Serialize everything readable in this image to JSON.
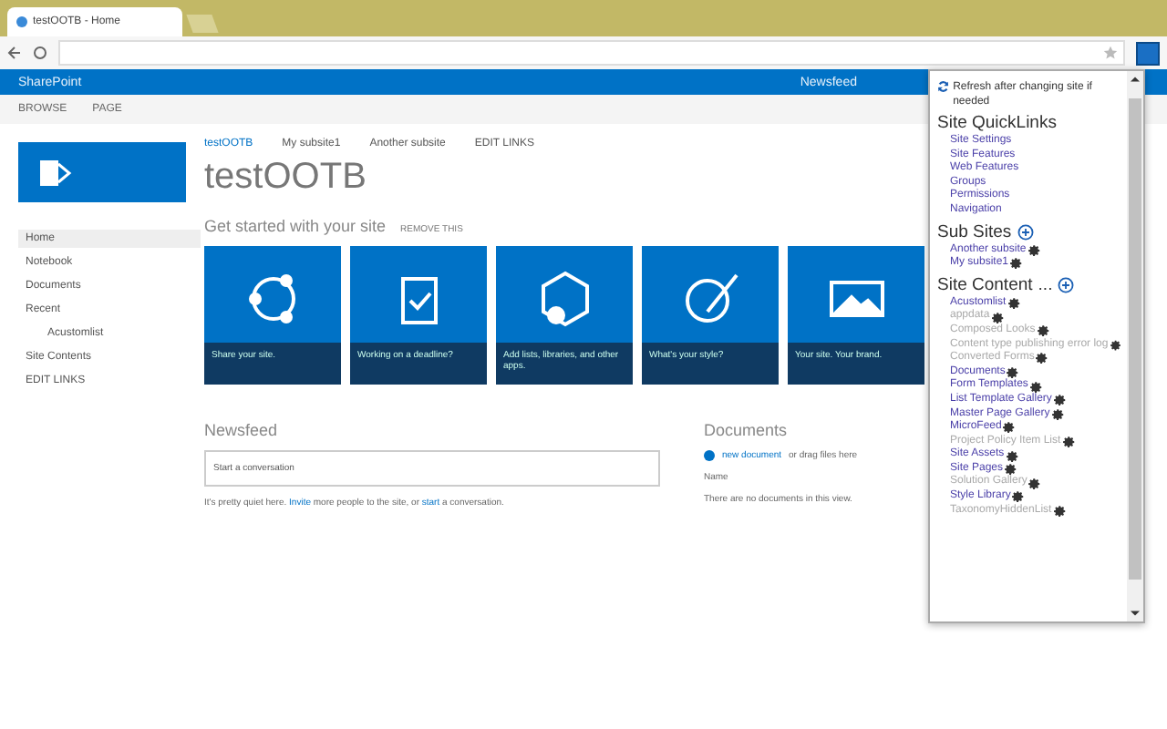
{
  "browser": {
    "tab_title": "testOOTB - Home"
  },
  "suite_bar": {
    "brand": "SharePoint",
    "links": [
      "Newsfeed"
    ]
  },
  "ribbon": {
    "tabs": [
      "BROWSE",
      "PAGE"
    ]
  },
  "site": {
    "top_links": [
      {
        "label": "testOOTB",
        "selected": true
      },
      {
        "label": "My subsite1",
        "selected": false
      },
      {
        "label": "Another subsite",
        "selected": false
      },
      {
        "label": "EDIT LINKS",
        "selected": false
      }
    ],
    "title": "testOOTB",
    "get_started": "Get started with your site",
    "remove": "REMOVE THIS"
  },
  "quick_launch": [
    {
      "label": "Home",
      "selected": true
    },
    {
      "label": "Notebook",
      "selected": false
    },
    {
      "label": "Documents",
      "selected": false
    },
    {
      "label": "Recent",
      "selected": false,
      "children": [
        {
          "label": "Acustomlist",
          "selected": false
        }
      ]
    },
    {
      "label": "Site Contents",
      "selected": false
    }
  ],
  "edit_links": "EDIT LINKS",
  "tiles": [
    "Share your site.",
    "Working on a deadline?",
    "Add lists, libraries, and other apps.",
    "What's your style?",
    "Your site. Your brand."
  ],
  "newsfeed": {
    "title": "Newsfeed",
    "placeholder": "Start a conversation",
    "note": "It's pretty quiet here. **Invite** more people to the site, or **start** a conversation."
  },
  "documents": {
    "title": "Documents",
    "new_link": "new document",
    "new_rest": "or drag files here",
    "name_col": "Name",
    "empty": "There are no documents in this view."
  },
  "popup": {
    "refresh": "Refresh after changing site if needed",
    "quicklinks_title": "Site QuickLinks",
    "quicklinks": [
      "Site Settings",
      "Site Features",
      "Web Features",
      "Groups",
      "Permissions",
      "Navigation"
    ],
    "subsites_title": "Sub Sites",
    "subsites": [
      "Another subsite",
      "My subsite1"
    ],
    "content_title": "Site Content",
    "more": "...",
    "content": [
      {
        "label": "Acustomlist",
        "hidden": false
      },
      {
        "label": "appdata",
        "hidden": true
      },
      {
        "label": "Composed Looks",
        "hidden": true
      },
      {
        "label": "Content type publishing error log",
        "hidden": true
      },
      {
        "label": "Converted Forms",
        "hidden": true
      },
      {
        "label": "Documents",
        "hidden": false
      },
      {
        "label": "Form Templates",
        "hidden": false
      },
      {
        "label": "List Template Gallery",
        "hidden": false
      },
      {
        "label": "Master Page Gallery",
        "hidden": false
      },
      {
        "label": "MicroFeed",
        "hidden": false
      },
      {
        "label": "Project Policy Item List",
        "hidden": true
      },
      {
        "label": "Site Assets",
        "hidden": false
      },
      {
        "label": "Site Pages",
        "hidden": false
      },
      {
        "label": "Solution Gallery",
        "hidden": true
      },
      {
        "label": "Style Library",
        "hidden": false
      },
      {
        "label": "TaxonomyHiddenList",
        "hidden": true
      }
    ]
  }
}
